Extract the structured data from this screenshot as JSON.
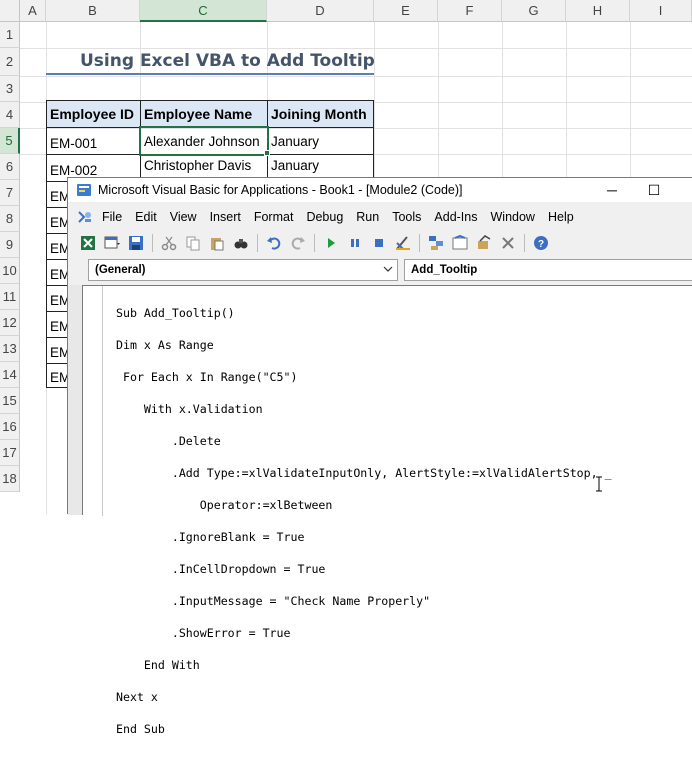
{
  "sheet": {
    "columns": [
      "A",
      "B",
      "C",
      "D",
      "E",
      "F",
      "G",
      "H",
      "I"
    ],
    "rows": [
      "1",
      "2",
      "3",
      "4",
      "5",
      "6",
      "7",
      "8",
      "9",
      "10",
      "11",
      "12",
      "13",
      "14",
      "15",
      "16",
      "17",
      "18"
    ],
    "title": "Using Excel VBA to Add Tooltip",
    "table": {
      "headers": [
        "Employee ID",
        "Employee Name",
        "Joining Month"
      ],
      "rows": [
        [
          "EM-001",
          "Alexander Johnson",
          "January"
        ],
        [
          "EM-002",
          "Christopher Davis",
          "January"
        ]
      ],
      "partial_ids": [
        "EM",
        "EM",
        "EM",
        "EM",
        "EM",
        "EM",
        "EM",
        "EM"
      ]
    },
    "selected_cell": "C5"
  },
  "vbe": {
    "title": "Microsoft Visual Basic for Applications - Book1 - [Module2 (Code)]",
    "window_controls": {
      "minimize": "─",
      "maximize": "☐"
    },
    "menu": [
      "File",
      "Edit",
      "View",
      "Insert",
      "Format",
      "Debug",
      "Run",
      "Tools",
      "Add-Ins",
      "Window",
      "Help"
    ],
    "object_combo": "(General)",
    "procedure_combo": "Add_Tooltip",
    "code_lines": [
      "Sub Add_Tooltip()",
      "Dim x As Range",
      " For Each x In Range(\"C5\")",
      "    With x.Validation",
      "        .Delete",
      "        .Add Type:=xlValidateInputOnly, AlertStyle:=xlValidAlertStop, _",
      "            Operator:=xlBetween",
      "        .IgnoreBlank = True",
      "        .InCellDropdown = True",
      "        .InputMessage = \"Check Name Properly\"",
      "        .ShowError = True",
      "    End With",
      "Next x",
      "End Sub"
    ]
  },
  "colors": {
    "accent": "#217346",
    "header_fill": "#dbe7f4",
    "keyword": "#00008b",
    "title": "#44546a"
  }
}
